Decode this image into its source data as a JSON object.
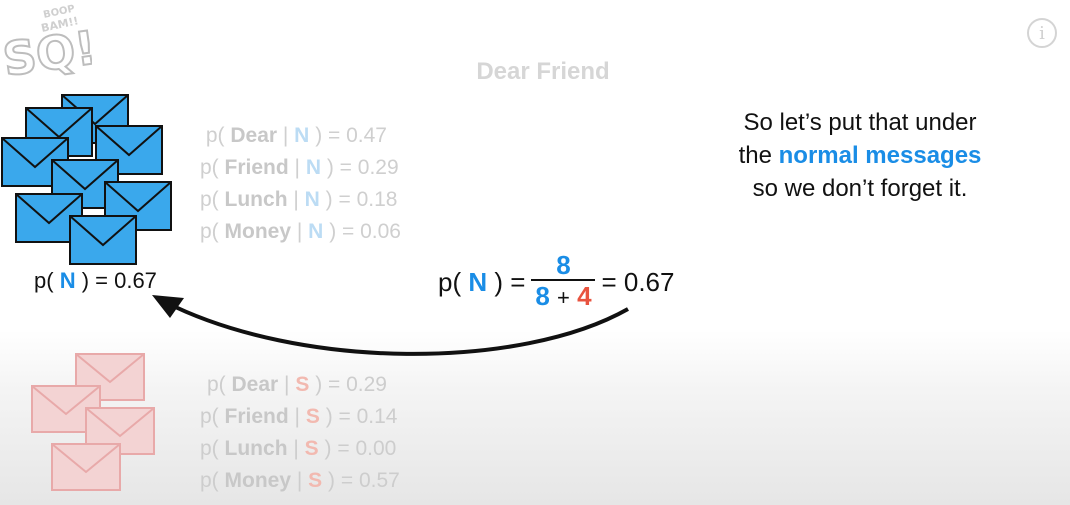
{
  "logo": {
    "line1": "BOOP",
    "line2": "BAM!!",
    "big": "SQ!"
  },
  "info": {
    "glyph": "i"
  },
  "phrase": "Dear Friend",
  "normal_probs": {
    "rows": [
      {
        "prefix": "p(",
        "word": "Dear",
        "cls": "N",
        "suffix": ") = 0.47"
      },
      {
        "prefix": "p(",
        "word": "Friend",
        "cls": "N",
        "suffix": ") = 0.29"
      },
      {
        "prefix": "p(",
        "word": "Lunch",
        "cls": "N",
        "suffix": ") = 0.18"
      },
      {
        "prefix": "p(",
        "word": "Money",
        "cls": "N",
        "suffix": ") = 0.06"
      }
    ]
  },
  "spam_probs": {
    "rows": [
      {
        "prefix": "p(",
        "word": "Dear",
        "cls": "S",
        "suffix": ") = 0.29"
      },
      {
        "prefix": "p(",
        "word": "Friend",
        "cls": "S",
        "suffix": ") = 0.14"
      },
      {
        "prefix": "p(",
        "word": "Lunch",
        "cls": "S",
        "suffix": ") = 0.00"
      },
      {
        "prefix": "p(",
        "word": "Money",
        "cls": "S",
        "suffix": ") = 0.57"
      }
    ]
  },
  "prior": {
    "prefix": "p(",
    "cls": "N",
    "suffix": ") = 0.67"
  },
  "formula": {
    "prefix": "p(",
    "cls": "N",
    "mid": ") =",
    "numerator": "8",
    "den_a": "8",
    "den_plus": "+",
    "den_b": "4",
    "result": "= 0.67"
  },
  "narration": {
    "line1": "So let’s put that under",
    "line2_pre": "the",
    "line2_highlight": "normal messages",
    "line3": "so we don’t forget it."
  },
  "colors": {
    "normal": "#1a8de6",
    "spam": "#e8533f",
    "envelope_blue": "#3aa8ec",
    "envelope_red": "#f3d3d3"
  }
}
